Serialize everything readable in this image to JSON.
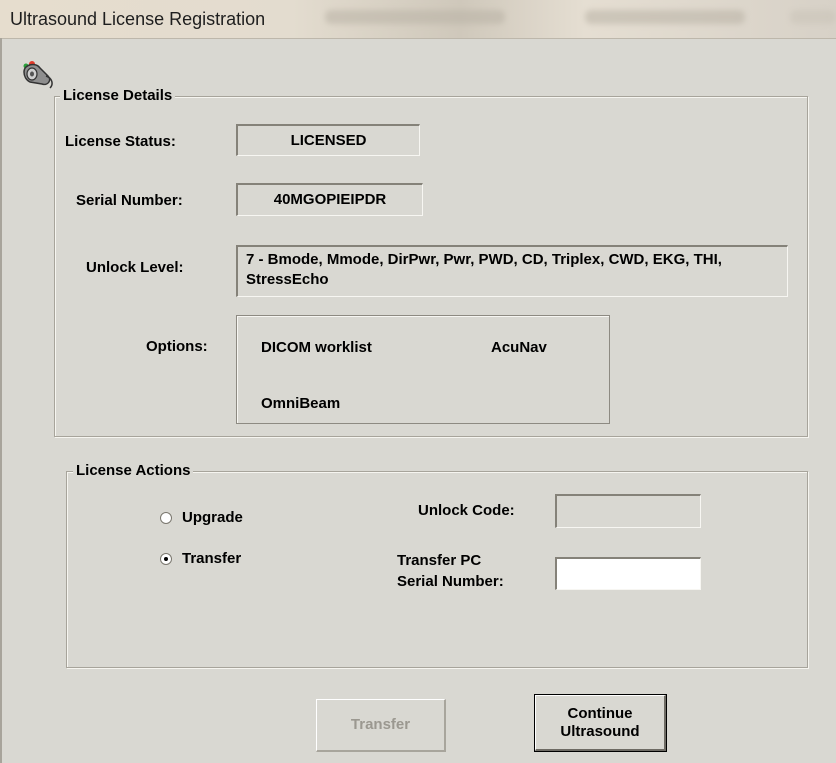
{
  "window": {
    "title": "Ultrasound License Registration"
  },
  "license_details": {
    "legend": "License Details",
    "status_label": "License Status:",
    "status_value": "LICENSED",
    "serial_label": "Serial Number:",
    "serial_value": "40MGOPIEIPDR",
    "unlock_label": "Unlock Level:",
    "unlock_value": "7 - Bmode, Mmode, DirPwr, Pwr, PWD, CD, Triplex, CWD, EKG, THI, StressEcho",
    "options_label": "Options:",
    "options": [
      "DICOM worklist",
      "AcuNav",
      "OmniBeam"
    ]
  },
  "license_actions": {
    "legend": "License Actions",
    "radio_upgrade": "Upgrade",
    "radio_transfer": "Transfer",
    "selected": "Transfer",
    "unlock_code_label": "Unlock Code:",
    "unlock_code_value": "",
    "transfer_serial_label_line1": "Transfer PC",
    "transfer_serial_label_line2": "Serial Number:",
    "transfer_serial_value": ""
  },
  "buttons": {
    "transfer": "Transfer",
    "continue_line1": "Continue",
    "continue_line2": "Ultrasound"
  },
  "icons": {
    "app": "ultrasound-probe-icon"
  },
  "colors": {
    "background": "#d9d8d2",
    "disabled_text": "#9b9890"
  }
}
